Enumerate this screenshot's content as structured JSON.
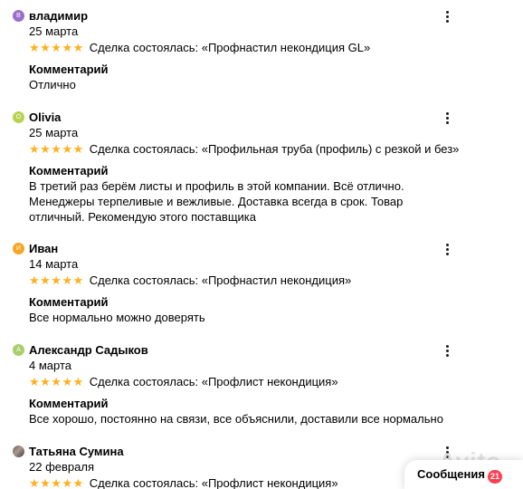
{
  "reviews": [
    {
      "initial": "В",
      "avatar_color": "#9b6fc9",
      "name": "владимир",
      "date": "25 марта",
      "stars": "★★★★★",
      "deal": "Сделка состоялась: «Профнастил некондиция GL»",
      "comment_label": "Комментарий",
      "comment": "Отлично"
    },
    {
      "initial": "O",
      "avatar_color": "#b8d24f",
      "name": "Olivia",
      "date": "25 марта",
      "stars": "★★★★★",
      "deal": "Сделка состоялась: «Профильная труба (профиль) с резкой и без»",
      "comment_label": "Комментарий",
      "comment": "В третий раз берём листы и профиль в этой компании. Всё отлично. Менеджеры терпеливые и вежливые. Доставка всегда в срок. Товар отличный. Рекомендую этого поставщика"
    },
    {
      "initial": "И",
      "avatar_color": "#f5a623",
      "name": "Иван",
      "date": "14 марта",
      "stars": "★★★★★",
      "deal": "Сделка состоялась: «Профнастил некондиция»",
      "comment_label": "Комментарий",
      "comment": "Все нормально можно доверять"
    },
    {
      "initial": "А",
      "avatar_color": "#a8cf6a",
      "name": "Александр Садыков",
      "date": "4 марта",
      "stars": "★★★★★",
      "deal": "Сделка состоялась: «Профлист некондиция»",
      "comment_label": "Комментарий",
      "comment": "Все хорошо, постоянно на связи, все объяснили, доставили все нормально"
    },
    {
      "initial": "",
      "avatar_color": "#7d6f66",
      "name": "Татьяна Сумина",
      "date": "22 февраля",
      "stars": "★★★★★",
      "deal": "Сделка состоялась: «Профлист некондиция»",
      "comment_label": "",
      "comment": ""
    }
  ],
  "messages": {
    "label": "Сообщения",
    "badge": "21"
  },
  "watermark": "Avito",
  "colors": {
    "star": "#ffb021",
    "badge": "#ff4053"
  },
  "icons": {
    "more": "more-vertical-icon",
    "star": "star-icon"
  }
}
